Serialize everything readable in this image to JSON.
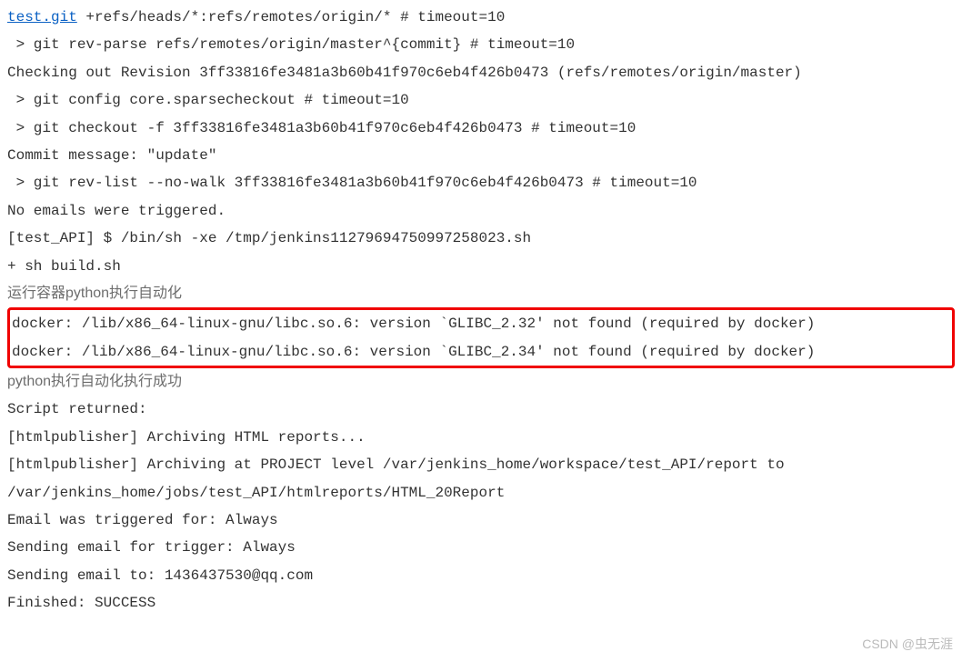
{
  "console": {
    "line1_link": "test.git",
    "line1_rest": " +refs/heads/*:refs/remotes/origin/* # timeout=10",
    "line2": " > git rev-parse refs/remotes/origin/master^{commit} # timeout=10",
    "line3": "Checking out Revision 3ff33816fe3481a3b60b41f970c6eb4f426b0473 (refs/remotes/origin/master)",
    "line4": " > git config core.sparsecheckout # timeout=10",
    "line5": " > git checkout -f 3ff33816fe3481a3b60b41f970c6eb4f426b0473 # timeout=10",
    "line6": "Commit message: \"update\"",
    "line7": " > git rev-list --no-walk 3ff33816fe3481a3b60b41f970c6eb4f426b0473 # timeout=10",
    "line8": "No emails were triggered.",
    "line9": "[test_API] $ /bin/sh -xe /tmp/jenkins11279694750997258023.sh",
    "line10": "+ sh build.sh",
    "line11": "运行容器python执行自动化",
    "error1": "docker: /lib/x86_64-linux-gnu/libc.so.6: version `GLIBC_2.32' not found (required by docker)",
    "error2": "docker: /lib/x86_64-linux-gnu/libc.so.6: version `GLIBC_2.34' not found (required by docker)",
    "line14": "python执行自动化执行成功",
    "line15": "Script returned:",
    "line16": "[htmlpublisher] Archiving HTML reports...",
    "line17": "[htmlpublisher] Archiving at PROJECT level /var/jenkins_home/workspace/test_API/report to ",
    "line18": "/var/jenkins_home/jobs/test_API/htmlreports/HTML_20Report",
    "line19": "Email was triggered for: Always",
    "line20": "Sending email for trigger: Always",
    "line21": "Sending email to: 1436437530@qq.com",
    "line22": "Finished: SUCCESS"
  },
  "watermark": "CSDN @虫无涯"
}
